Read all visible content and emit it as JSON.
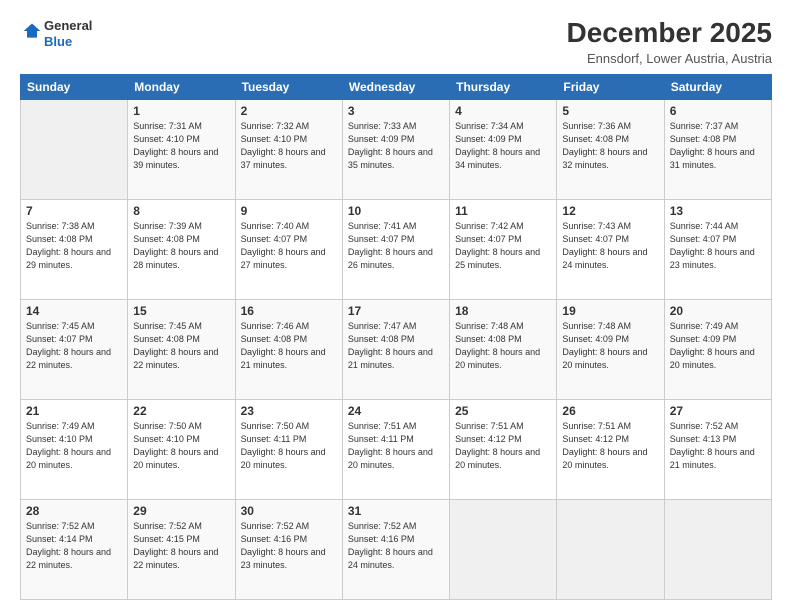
{
  "logo": {
    "general": "General",
    "blue": "Blue"
  },
  "header": {
    "title": "December 2025",
    "subtitle": "Ennsdorf, Lower Austria, Austria"
  },
  "weekdays": [
    "Sunday",
    "Monday",
    "Tuesday",
    "Wednesday",
    "Thursday",
    "Friday",
    "Saturday"
  ],
  "weeks": [
    [
      {
        "day": "",
        "empty": true
      },
      {
        "day": "1",
        "sunrise": "Sunrise: 7:31 AM",
        "sunset": "Sunset: 4:10 PM",
        "daylight": "Daylight: 8 hours and 39 minutes."
      },
      {
        "day": "2",
        "sunrise": "Sunrise: 7:32 AM",
        "sunset": "Sunset: 4:10 PM",
        "daylight": "Daylight: 8 hours and 37 minutes."
      },
      {
        "day": "3",
        "sunrise": "Sunrise: 7:33 AM",
        "sunset": "Sunset: 4:09 PM",
        "daylight": "Daylight: 8 hours and 35 minutes."
      },
      {
        "day": "4",
        "sunrise": "Sunrise: 7:34 AM",
        "sunset": "Sunset: 4:09 PM",
        "daylight": "Daylight: 8 hours and 34 minutes."
      },
      {
        "day": "5",
        "sunrise": "Sunrise: 7:36 AM",
        "sunset": "Sunset: 4:08 PM",
        "daylight": "Daylight: 8 hours and 32 minutes."
      },
      {
        "day": "6",
        "sunrise": "Sunrise: 7:37 AM",
        "sunset": "Sunset: 4:08 PM",
        "daylight": "Daylight: 8 hours and 31 minutes."
      }
    ],
    [
      {
        "day": "7",
        "sunrise": "Sunrise: 7:38 AM",
        "sunset": "Sunset: 4:08 PM",
        "daylight": "Daylight: 8 hours and 29 minutes."
      },
      {
        "day": "8",
        "sunrise": "Sunrise: 7:39 AM",
        "sunset": "Sunset: 4:08 PM",
        "daylight": "Daylight: 8 hours and 28 minutes."
      },
      {
        "day": "9",
        "sunrise": "Sunrise: 7:40 AM",
        "sunset": "Sunset: 4:07 PM",
        "daylight": "Daylight: 8 hours and 27 minutes."
      },
      {
        "day": "10",
        "sunrise": "Sunrise: 7:41 AM",
        "sunset": "Sunset: 4:07 PM",
        "daylight": "Daylight: 8 hours and 26 minutes."
      },
      {
        "day": "11",
        "sunrise": "Sunrise: 7:42 AM",
        "sunset": "Sunset: 4:07 PM",
        "daylight": "Daylight: 8 hours and 25 minutes."
      },
      {
        "day": "12",
        "sunrise": "Sunrise: 7:43 AM",
        "sunset": "Sunset: 4:07 PM",
        "daylight": "Daylight: 8 hours and 24 minutes."
      },
      {
        "day": "13",
        "sunrise": "Sunrise: 7:44 AM",
        "sunset": "Sunset: 4:07 PM",
        "daylight": "Daylight: 8 hours and 23 minutes."
      }
    ],
    [
      {
        "day": "14",
        "sunrise": "Sunrise: 7:45 AM",
        "sunset": "Sunset: 4:07 PM",
        "daylight": "Daylight: 8 hours and 22 minutes."
      },
      {
        "day": "15",
        "sunrise": "Sunrise: 7:45 AM",
        "sunset": "Sunset: 4:08 PM",
        "daylight": "Daylight: 8 hours and 22 minutes."
      },
      {
        "day": "16",
        "sunrise": "Sunrise: 7:46 AM",
        "sunset": "Sunset: 4:08 PM",
        "daylight": "Daylight: 8 hours and 21 minutes."
      },
      {
        "day": "17",
        "sunrise": "Sunrise: 7:47 AM",
        "sunset": "Sunset: 4:08 PM",
        "daylight": "Daylight: 8 hours and 21 minutes."
      },
      {
        "day": "18",
        "sunrise": "Sunrise: 7:48 AM",
        "sunset": "Sunset: 4:08 PM",
        "daylight": "Daylight: 8 hours and 20 minutes."
      },
      {
        "day": "19",
        "sunrise": "Sunrise: 7:48 AM",
        "sunset": "Sunset: 4:09 PM",
        "daylight": "Daylight: 8 hours and 20 minutes."
      },
      {
        "day": "20",
        "sunrise": "Sunrise: 7:49 AM",
        "sunset": "Sunset: 4:09 PM",
        "daylight": "Daylight: 8 hours and 20 minutes."
      }
    ],
    [
      {
        "day": "21",
        "sunrise": "Sunrise: 7:49 AM",
        "sunset": "Sunset: 4:10 PM",
        "daylight": "Daylight: 8 hours and 20 minutes."
      },
      {
        "day": "22",
        "sunrise": "Sunrise: 7:50 AM",
        "sunset": "Sunset: 4:10 PM",
        "daylight": "Daylight: 8 hours and 20 minutes."
      },
      {
        "day": "23",
        "sunrise": "Sunrise: 7:50 AM",
        "sunset": "Sunset: 4:11 PM",
        "daylight": "Daylight: 8 hours and 20 minutes."
      },
      {
        "day": "24",
        "sunrise": "Sunrise: 7:51 AM",
        "sunset": "Sunset: 4:11 PM",
        "daylight": "Daylight: 8 hours and 20 minutes."
      },
      {
        "day": "25",
        "sunrise": "Sunrise: 7:51 AM",
        "sunset": "Sunset: 4:12 PM",
        "daylight": "Daylight: 8 hours and 20 minutes."
      },
      {
        "day": "26",
        "sunrise": "Sunrise: 7:51 AM",
        "sunset": "Sunset: 4:12 PM",
        "daylight": "Daylight: 8 hours and 20 minutes."
      },
      {
        "day": "27",
        "sunrise": "Sunrise: 7:52 AM",
        "sunset": "Sunset: 4:13 PM",
        "daylight": "Daylight: 8 hours and 21 minutes."
      }
    ],
    [
      {
        "day": "28",
        "sunrise": "Sunrise: 7:52 AM",
        "sunset": "Sunset: 4:14 PM",
        "daylight": "Daylight: 8 hours and 22 minutes."
      },
      {
        "day": "29",
        "sunrise": "Sunrise: 7:52 AM",
        "sunset": "Sunset: 4:15 PM",
        "daylight": "Daylight: 8 hours and 22 minutes."
      },
      {
        "day": "30",
        "sunrise": "Sunrise: 7:52 AM",
        "sunset": "Sunset: 4:16 PM",
        "daylight": "Daylight: 8 hours and 23 minutes."
      },
      {
        "day": "31",
        "sunrise": "Sunrise: 7:52 AM",
        "sunset": "Sunset: 4:16 PM",
        "daylight": "Daylight: 8 hours and 24 minutes."
      },
      {
        "day": "",
        "empty": true
      },
      {
        "day": "",
        "empty": true
      },
      {
        "day": "",
        "empty": true
      }
    ]
  ]
}
